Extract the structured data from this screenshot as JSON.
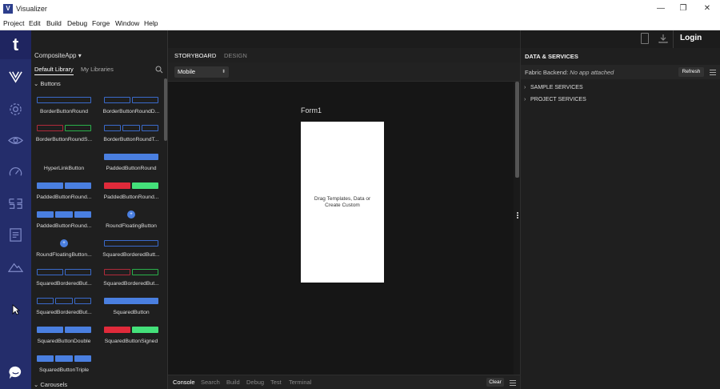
{
  "window": {
    "title": "Visualizer",
    "icon_letter": "V",
    "minimize": "—",
    "maximize": "❐",
    "close": "✕"
  },
  "menubar": [
    "Project",
    "Edit",
    "Build",
    "Debug",
    "Forge",
    "Window",
    "Help"
  ],
  "leftnav": {
    "logo": "t",
    "icons": [
      "visualizer-icon",
      "settings-icon",
      "preview-icon",
      "dashboard-icon",
      "layout-icon",
      "document-icon",
      "mountain-icon",
      "chat-icon"
    ]
  },
  "library": {
    "project_selector": "CompositeApp ▾",
    "tabs": [
      "Default Library",
      "My Libraries"
    ],
    "section_buttons": "Buttons",
    "section_carousels": "Carousels",
    "widgets": [
      {
        "label": "BorderButtonRound"
      },
      {
        "label": "BorderButtonRoundD..."
      },
      {
        "label": "BorderButtonRoundS..."
      },
      {
        "label": "BorderButtonRoundT..."
      },
      {
        "label": "HyperLinkButton"
      },
      {
        "label": "PaddedButtonRound"
      },
      {
        "label": "PaddedButtonRound..."
      },
      {
        "label": "PaddedButtonRound..."
      },
      {
        "label": "PaddedButtonRound..."
      },
      {
        "label": "RoundFloatingButton"
      },
      {
        "label": "RoundFloatingButton..."
      },
      {
        "label": "SquaredBorderedButt..."
      },
      {
        "label": "SquaredBorderedBut..."
      },
      {
        "label": "SquaredBorderedBut..."
      },
      {
        "label": "SquaredBorderedBut..."
      },
      {
        "label": "SquaredButton"
      },
      {
        "label": "SquaredButtonDouble"
      },
      {
        "label": "SquaredButtonSigned"
      },
      {
        "label": "SquaredButtonTriple"
      }
    ]
  },
  "storyboard": {
    "tabs": [
      "STORYBOARD",
      "DESIGN"
    ],
    "device": "Mobile",
    "form_title": "Form1",
    "form_hint": "Drag Templates, Data or Create Custom",
    "bottom_tabs": [
      "Console",
      "Search",
      "Build",
      "Debug",
      "Test",
      "Terminal"
    ],
    "clear": "Clear"
  },
  "right": {
    "login": "Login",
    "header": "DATA & SERVICES",
    "backend_label": "Fabric Backend:",
    "backend_value": "No app attached",
    "refresh": "Refresh",
    "tree": [
      "SAMPLE SERVICES",
      "PROJECT SERVICES"
    ]
  },
  "colors": {
    "nav_bg": "#242d6b",
    "accent_blue": "#4a7fe0",
    "accent_red": "#e02a3a",
    "accent_green": "#44e07a"
  }
}
